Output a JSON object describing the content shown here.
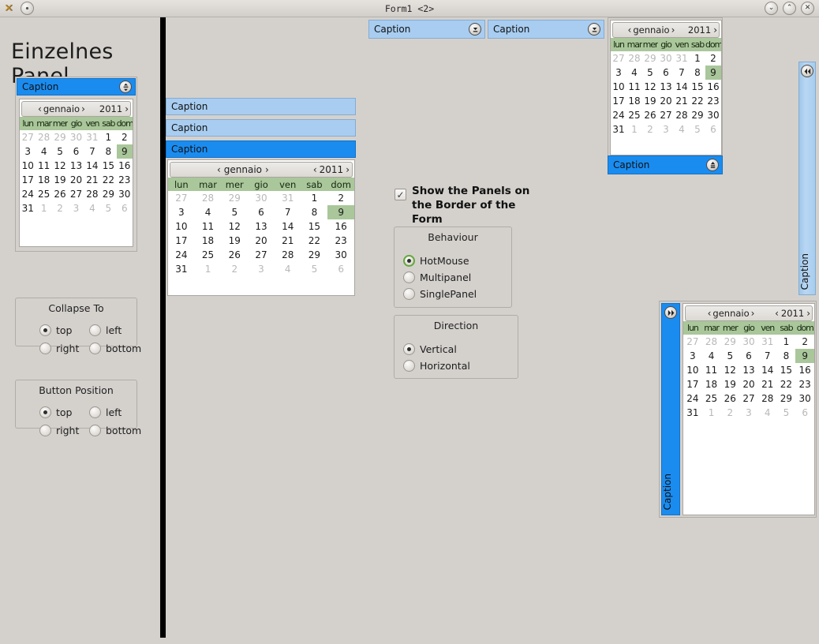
{
  "window": {
    "title": "Form1 <2>",
    "app_icon": "x-logo-icon",
    "menu_icon": "window-menu-icon",
    "controls": [
      {
        "name": "minimize-button",
        "glyph": "⌄"
      },
      {
        "name": "maximize-button",
        "glyph": "⌃"
      },
      {
        "name": "close-button",
        "glyph": "✕"
      }
    ]
  },
  "left_dock": {
    "headline": "Einzelnes Panel",
    "panel": {
      "caption": "Caption",
      "state": "active",
      "collapse_button": "collapse-updown-icon"
    },
    "collapse_to": {
      "title": "Collapse To",
      "options": [
        {
          "label": "top",
          "selected": true
        },
        {
          "label": "left",
          "selected": false
        },
        {
          "label": "right",
          "selected": false
        },
        {
          "label": "bottom",
          "selected": false
        }
      ]
    },
    "button_position": {
      "title": "Button Position",
      "options": [
        {
          "label": "top",
          "selected": true
        },
        {
          "label": "left",
          "selected": false
        },
        {
          "label": "right",
          "selected": false
        },
        {
          "label": "bottom",
          "selected": false
        }
      ]
    }
  },
  "center_stack": {
    "bars": [
      {
        "caption": "Caption",
        "state": "inactive"
      },
      {
        "caption": "Caption",
        "state": "inactive"
      },
      {
        "caption": "Caption",
        "state": "active"
      }
    ]
  },
  "top_bars": [
    {
      "caption": "Caption",
      "state": "inactive",
      "button": "collapse-updown-icon"
    },
    {
      "caption": "Caption",
      "state": "inactive",
      "button": "collapse-updown-icon"
    }
  ],
  "top_right_panel": {
    "caption": "Caption",
    "state": "active",
    "collapse_button": "collapse-updown-icon"
  },
  "right_strip": {
    "caption": "Caption",
    "state": "inactive",
    "collapse_button": "collapse-left-icon"
  },
  "bottom_right_panel": {
    "caption": "Caption",
    "state": "active",
    "collapse_button": "collapse-right-icon"
  },
  "options": {
    "checkbox": {
      "label": "Show the Panels on the Border of the Form",
      "checked": true,
      "glyph": "✓"
    },
    "behaviour": {
      "title": "Behaviour",
      "options": [
        {
          "label": "HotMouse",
          "selected": true,
          "focused": true
        },
        {
          "label": "Multipanel",
          "selected": false,
          "focused": false
        },
        {
          "label": "SinglePanel",
          "selected": false,
          "focused": false
        }
      ]
    },
    "direction": {
      "title": "Direction",
      "options": [
        {
          "label": "Vertical",
          "selected": true,
          "focused": false
        },
        {
          "label": "Horizontal",
          "selected": false,
          "focused": false
        }
      ]
    }
  },
  "calendar": {
    "month": "gennaio",
    "year": "2011",
    "prev_glyph": "‹",
    "next_glyph": "›",
    "weekdays": [
      "lun",
      "mar",
      "mer",
      "gio",
      "ven",
      "sab",
      "dom"
    ],
    "weeks": [
      [
        {
          "d": "27",
          "m": "dim"
        },
        {
          "d": "28",
          "m": "dim"
        },
        {
          "d": "29",
          "m": "dim"
        },
        {
          "d": "30",
          "m": "dim"
        },
        {
          "d": "31",
          "m": "dim"
        },
        {
          "d": "1",
          "m": ""
        },
        {
          "d": "2",
          "m": ""
        }
      ],
      [
        {
          "d": "3",
          "m": ""
        },
        {
          "d": "4",
          "m": ""
        },
        {
          "d": "5",
          "m": ""
        },
        {
          "d": "6",
          "m": ""
        },
        {
          "d": "7",
          "m": ""
        },
        {
          "d": "8",
          "m": ""
        },
        {
          "d": "9",
          "m": "sel"
        }
      ],
      [
        {
          "d": "10",
          "m": ""
        },
        {
          "d": "11",
          "m": ""
        },
        {
          "d": "12",
          "m": ""
        },
        {
          "d": "13",
          "m": ""
        },
        {
          "d": "14",
          "m": ""
        },
        {
          "d": "15",
          "m": ""
        },
        {
          "d": "16",
          "m": ""
        }
      ],
      [
        {
          "d": "17",
          "m": ""
        },
        {
          "d": "18",
          "m": ""
        },
        {
          "d": "19",
          "m": ""
        },
        {
          "d": "20",
          "m": ""
        },
        {
          "d": "21",
          "m": ""
        },
        {
          "d": "22",
          "m": ""
        },
        {
          "d": "23",
          "m": ""
        }
      ],
      [
        {
          "d": "24",
          "m": ""
        },
        {
          "d": "25",
          "m": ""
        },
        {
          "d": "26",
          "m": ""
        },
        {
          "d": "27",
          "m": ""
        },
        {
          "d": "28",
          "m": ""
        },
        {
          "d": "29",
          "m": ""
        },
        {
          "d": "30",
          "m": ""
        }
      ],
      [
        {
          "d": "31",
          "m": ""
        },
        {
          "d": "1",
          "m": "dim"
        },
        {
          "d": "2",
          "m": "dim"
        },
        {
          "d": "3",
          "m": "dim"
        },
        {
          "d": "4",
          "m": "dim"
        },
        {
          "d": "5",
          "m": "dim"
        },
        {
          "d": "6",
          "m": "dim"
        }
      ]
    ],
    "selected_day": "9"
  },
  "colors": {
    "background": "#d4d1cd",
    "caption_active": "#1a8cf0",
    "caption_inactive": "#a8cdf0",
    "calendar_header": "#a9c79a",
    "selection": "#a9c79a",
    "splitter": "#000000",
    "focus_ring": "#63a83b"
  }
}
